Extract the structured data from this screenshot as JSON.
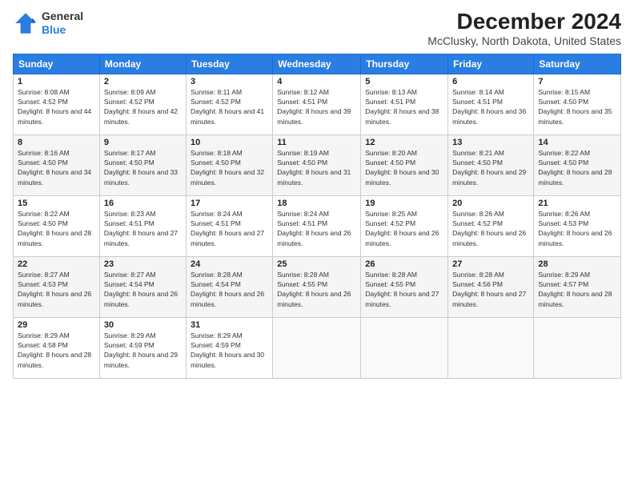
{
  "logo": {
    "general": "General",
    "blue": "Blue"
  },
  "header": {
    "month_year": "December 2024",
    "location": "McClusky, North Dakota, United States"
  },
  "weekdays": [
    "Sunday",
    "Monday",
    "Tuesday",
    "Wednesday",
    "Thursday",
    "Friday",
    "Saturday"
  ],
  "weeks": [
    [
      {
        "day": "1",
        "sunrise": "8:08 AM",
        "sunset": "4:52 PM",
        "daylight": "8 hours and 44 minutes."
      },
      {
        "day": "2",
        "sunrise": "8:09 AM",
        "sunset": "4:52 PM",
        "daylight": "8 hours and 42 minutes."
      },
      {
        "day": "3",
        "sunrise": "8:11 AM",
        "sunset": "4:52 PM",
        "daylight": "8 hours and 41 minutes."
      },
      {
        "day": "4",
        "sunrise": "8:12 AM",
        "sunset": "4:51 PM",
        "daylight": "8 hours and 39 minutes."
      },
      {
        "day": "5",
        "sunrise": "8:13 AM",
        "sunset": "4:51 PM",
        "daylight": "8 hours and 38 minutes."
      },
      {
        "day": "6",
        "sunrise": "8:14 AM",
        "sunset": "4:51 PM",
        "daylight": "8 hours and 36 minutes."
      },
      {
        "day": "7",
        "sunrise": "8:15 AM",
        "sunset": "4:50 PM",
        "daylight": "8 hours and 35 minutes."
      }
    ],
    [
      {
        "day": "8",
        "sunrise": "8:16 AM",
        "sunset": "4:50 PM",
        "daylight": "8 hours and 34 minutes."
      },
      {
        "day": "9",
        "sunrise": "8:17 AM",
        "sunset": "4:50 PM",
        "daylight": "8 hours and 33 minutes."
      },
      {
        "day": "10",
        "sunrise": "8:18 AM",
        "sunset": "4:50 PM",
        "daylight": "8 hours and 32 minutes."
      },
      {
        "day": "11",
        "sunrise": "8:19 AM",
        "sunset": "4:50 PM",
        "daylight": "8 hours and 31 minutes."
      },
      {
        "day": "12",
        "sunrise": "8:20 AM",
        "sunset": "4:50 PM",
        "daylight": "8 hours and 30 minutes."
      },
      {
        "day": "13",
        "sunrise": "8:21 AM",
        "sunset": "4:50 PM",
        "daylight": "8 hours and 29 minutes."
      },
      {
        "day": "14",
        "sunrise": "8:22 AM",
        "sunset": "4:50 PM",
        "daylight": "8 hours and 28 minutes."
      }
    ],
    [
      {
        "day": "15",
        "sunrise": "8:22 AM",
        "sunset": "4:50 PM",
        "daylight": "8 hours and 28 minutes."
      },
      {
        "day": "16",
        "sunrise": "8:23 AM",
        "sunset": "4:51 PM",
        "daylight": "8 hours and 27 minutes."
      },
      {
        "day": "17",
        "sunrise": "8:24 AM",
        "sunset": "4:51 PM",
        "daylight": "8 hours and 27 minutes."
      },
      {
        "day": "18",
        "sunrise": "8:24 AM",
        "sunset": "4:51 PM",
        "daylight": "8 hours and 26 minutes."
      },
      {
        "day": "19",
        "sunrise": "8:25 AM",
        "sunset": "4:52 PM",
        "daylight": "8 hours and 26 minutes."
      },
      {
        "day": "20",
        "sunrise": "8:26 AM",
        "sunset": "4:52 PM",
        "daylight": "8 hours and 26 minutes."
      },
      {
        "day": "21",
        "sunrise": "8:26 AM",
        "sunset": "4:53 PM",
        "daylight": "8 hours and 26 minutes."
      }
    ],
    [
      {
        "day": "22",
        "sunrise": "8:27 AM",
        "sunset": "4:53 PM",
        "daylight": "8 hours and 26 minutes."
      },
      {
        "day": "23",
        "sunrise": "8:27 AM",
        "sunset": "4:54 PM",
        "daylight": "8 hours and 26 minutes."
      },
      {
        "day": "24",
        "sunrise": "8:28 AM",
        "sunset": "4:54 PM",
        "daylight": "8 hours and 26 minutes."
      },
      {
        "day": "25",
        "sunrise": "8:28 AM",
        "sunset": "4:55 PM",
        "daylight": "8 hours and 26 minutes."
      },
      {
        "day": "26",
        "sunrise": "8:28 AM",
        "sunset": "4:55 PM",
        "daylight": "8 hours and 27 minutes."
      },
      {
        "day": "27",
        "sunrise": "8:28 AM",
        "sunset": "4:56 PM",
        "daylight": "8 hours and 27 minutes."
      },
      {
        "day": "28",
        "sunrise": "8:29 AM",
        "sunset": "4:57 PM",
        "daylight": "8 hours and 28 minutes."
      }
    ],
    [
      {
        "day": "29",
        "sunrise": "8:29 AM",
        "sunset": "4:58 PM",
        "daylight": "8 hours and 28 minutes."
      },
      {
        "day": "30",
        "sunrise": "8:29 AM",
        "sunset": "4:59 PM",
        "daylight": "8 hours and 29 minutes."
      },
      {
        "day": "31",
        "sunrise": "8:29 AM",
        "sunset": "4:59 PM",
        "daylight": "8 hours and 30 minutes."
      },
      null,
      null,
      null,
      null
    ]
  ]
}
